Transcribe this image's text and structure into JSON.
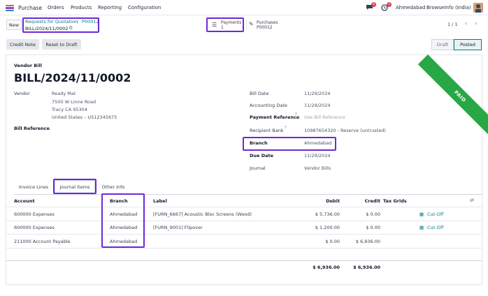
{
  "nav": {
    "app_name": "Purchase",
    "menu": [
      "Orders",
      "Products",
      "Reporting",
      "Configuration"
    ],
    "chat_count": "6",
    "activity_count": "2",
    "branch": "Ahmedabad",
    "company": "BrowseInfo (India)"
  },
  "control": {
    "new_label": "New",
    "breadcrumb_parent": "Requests for Quotation",
    "breadcrumb_sep": "/",
    "breadcrumb_order": "P00012",
    "record_name": "BILL/2024/11/0002",
    "smart_payments_label": "Payments",
    "smart_payments_count": "1",
    "smart_purchases_label": "Purchases",
    "smart_purchases_value": "P00012",
    "pager": "1 / 1"
  },
  "actions": {
    "credit_note": "Credit Note",
    "reset_to_draft": "Reset to Draft"
  },
  "status": {
    "draft": "Draft",
    "posted": "Posted",
    "ribbon": "PAID"
  },
  "bill": {
    "type_label": "Vendor Bill",
    "number": "BILL/2024/11/0002",
    "vendor_label": "Vendor",
    "vendor_name": "Ready Mat",
    "vendor_address": [
      "7500 W Linne Road",
      "Tracy CA 95304",
      "United States – US12345675"
    ],
    "bill_reference_label": "Bill Reference",
    "bill_date_label": "Bill Date",
    "bill_date": "11/29/2024",
    "accounting_date_label": "Accounting Date",
    "accounting_date": "11/29/2024",
    "payment_reference_label": "Payment Reference",
    "payment_reference_placeholder": "Use Bill Reference",
    "recipient_bank_label": "Recipient Bank",
    "recipient_bank": "10987654320 - Reserve (untrusted)",
    "branch_label": "Branch",
    "branch": "Ahmedabad",
    "due_date_label": "Due Date",
    "due_date": "11/29/2024",
    "journal_label": "Journal",
    "journal": "Vendor Bills"
  },
  "tabs": [
    "Invoice Lines",
    "Journal Items",
    "Other Info"
  ],
  "table": {
    "headers": {
      "account": "Account",
      "branch": "Branch",
      "label": "Label",
      "debit": "Debit",
      "credit": "Credit",
      "tax_grids": "Tax Grids"
    },
    "rows": [
      {
        "account": "600000 Expenses",
        "branch": "Ahmedabad",
        "label": "[FURN_6667] Acoustic Bloc Screens (Wood)",
        "debit": "$ 5,736.00",
        "credit": "$ 0.00",
        "cutoff": "Cut-Off"
      },
      {
        "account": "600000 Expenses",
        "branch": "Ahmedabad",
        "label": "[FURN_9001] Flipover",
        "debit": "$ 1,200.00",
        "credit": "$ 0.00",
        "cutoff": "Cut-Off"
      },
      {
        "account": "211000 Account Payable",
        "branch": "Ahmedabad",
        "label": "",
        "debit": "$ 0.00",
        "credit": "$ 6,936.00",
        "cutoff": ""
      }
    ],
    "total_debit": "$ 6,936.00",
    "total_credit": "$ 6,936.00"
  },
  "colors": {
    "accent": "#017e84",
    "highlight": "#6d28d9",
    "paid_ribbon": "#28a745",
    "badge": "#d9434e"
  }
}
